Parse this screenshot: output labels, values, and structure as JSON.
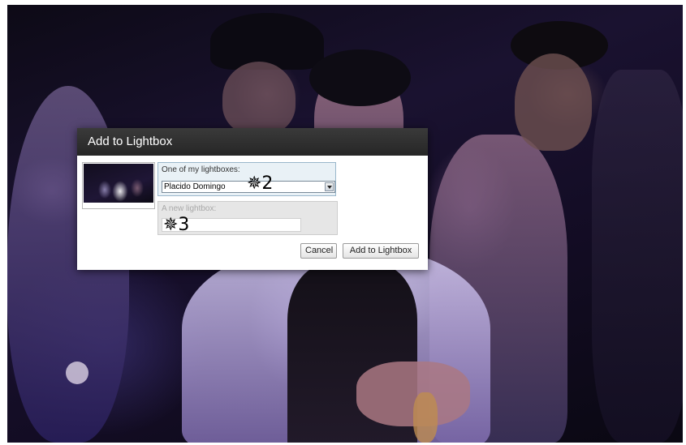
{
  "dialog": {
    "title": "Add to Lightbox",
    "existing_lightbox": {
      "label": "One of my lightboxes:",
      "selected_value": "Placido Domingo"
    },
    "new_lightbox": {
      "label": "A new lightbox:",
      "value": ""
    },
    "buttons": {
      "cancel_label": "Cancel",
      "add_label": "Add to Lightbox"
    }
  },
  "annotations": {
    "arrow_2": "✵2",
    "arrow_3": "✵3"
  },
  "colors": {
    "header_bg": "#2e2e2e",
    "existing_group_bg": "#e9f1f6",
    "new_group_bg": "#e6e6e6"
  }
}
